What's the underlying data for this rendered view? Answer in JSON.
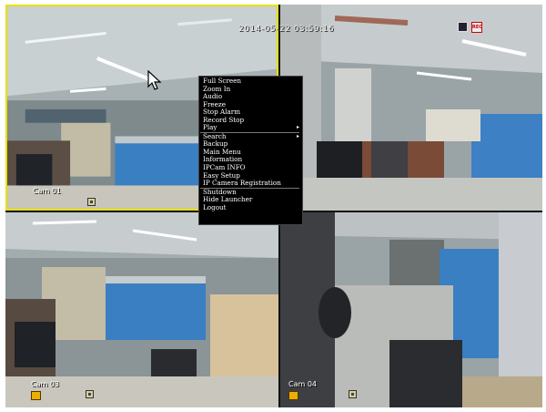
{
  "overlay": {
    "timestamp": "2014-05-22 03:59:16",
    "status_icons": [
      "hdd-icon",
      "rec-icon"
    ],
    "rec_label": "REC"
  },
  "cameras": [
    {
      "label": "Cam 01",
      "selected": true
    },
    {
      "label": "",
      "selected": false
    },
    {
      "label": "Cam 03",
      "selected": false
    },
    {
      "label": "Cam 04",
      "selected": false
    }
  ],
  "context_menu": {
    "items": [
      {
        "label": "Full Screen"
      },
      {
        "label": "Zoom In"
      },
      {
        "label": "Audio"
      },
      {
        "label": "Freeze"
      },
      {
        "label": "Stop Alarm"
      },
      {
        "label": "Record Stop"
      },
      {
        "label": "Play",
        "submenu": true
      },
      {
        "label": "Search",
        "submenu": true
      },
      {
        "label": "Backup"
      },
      {
        "label": "Main Menu"
      },
      {
        "label": "Information"
      },
      {
        "label": "IPCam INFO"
      },
      {
        "label": "Easy Setup"
      },
      {
        "label": "IP Camera Registration"
      },
      {
        "label": "Shutdown"
      },
      {
        "label": "Hide Launcher"
      },
      {
        "label": "Logout"
      }
    ],
    "arrow_glyph": "▸"
  },
  "colors": {
    "selection_border": "#e8e000",
    "menu_bg": "#000000",
    "menu_text": "#ffffff"
  }
}
